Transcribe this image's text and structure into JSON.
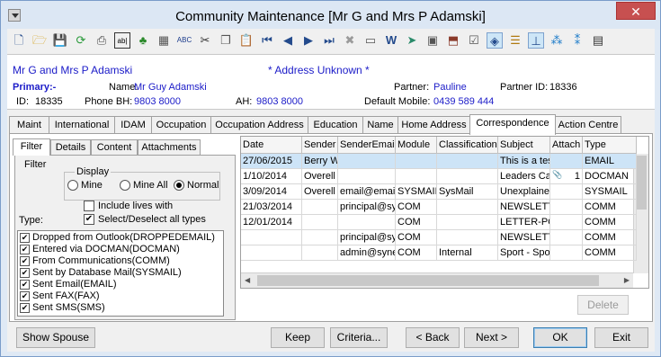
{
  "window": {
    "title": "Community Maintenance  [Mr G and Mrs P Adamski]",
    "close_label": "✕"
  },
  "header": {
    "name": "Mr G and Mrs P Adamski",
    "address_status": "* Address Unknown *",
    "primary_label": "Primary:-",
    "name_label": "Name:",
    "name_value": "Mr Guy Adamski",
    "partner_label": "Partner:",
    "partner_value": "Pauline",
    "partner_id_label": "Partner ID:",
    "partner_id_value": "18336",
    "id_label": "ID:",
    "id_value": "18335",
    "phone_bh_label": "Phone BH:",
    "phone_bh_value": "9803 8000",
    "ah_label": "AH:",
    "ah_value": "9803 8000",
    "default_mobile_label": "Default Mobile:",
    "default_mobile_value": "0439 589 444"
  },
  "tabs": [
    "Maint",
    "International",
    "IDAM",
    "Occupation",
    "Occupation Address",
    "Education",
    "Name",
    "Home Address",
    "Correspondence",
    "Action Centre"
  ],
  "subtabs": [
    "Filter",
    "Details",
    "Content",
    "Attachments"
  ],
  "filter": {
    "title": "Filter",
    "display_title": "Display",
    "radios": [
      "Mine",
      "Mine All",
      "Normal"
    ],
    "include_lives": "Include lives with",
    "select_all": "Select/Deselect all types",
    "type_label": "Type:",
    "types": [
      "Dropped from Outlook(DROPPEDEMAIL)",
      "Entered via DOCMAN(DOCMAN)",
      "From Communications(COMM)",
      "Sent by Database Mail(SYSMAIL)",
      "Sent Email(EMAIL)",
      "Sent FAX(FAX)",
      "Sent SMS(SMS)"
    ]
  },
  "grid": {
    "columns": [
      "Date",
      "Sender",
      "SenderEmail",
      "Module",
      "Classification",
      "Subject",
      "Attach",
      "Type"
    ],
    "rows": [
      [
        "27/06/2015",
        "Berry W",
        "",
        "",
        "",
        "This is a tes",
        "",
        "EMAIL"
      ],
      [
        "1/10/2014",
        "Overell S",
        "",
        "",
        "",
        "Leaders Car",
        "1",
        "DOCMAN"
      ],
      [
        "3/09/2014",
        "Overell S",
        "email@emailx",
        "SYSMAIL",
        "SysMail",
        "Unexplained",
        "",
        "SYSMAIL"
      ],
      [
        "21/03/2014",
        "",
        "principal@sy",
        "COM",
        "",
        "NEWSLETTE",
        "",
        "COMM"
      ],
      [
        "12/01/2014",
        "",
        "",
        "COM",
        "",
        "LETTER-PC-",
        "",
        "COMM"
      ],
      [
        "",
        "",
        "principal@sy",
        "COM",
        "",
        "NEWSLETTE",
        "",
        "COMM"
      ],
      [
        "",
        "",
        "admin@syne",
        "COM",
        "Internal",
        "Sport - Spor",
        "",
        "COMM"
      ]
    ]
  },
  "buttons": {
    "delete": "Delete",
    "show_spouse": "Show Spouse",
    "keep": "Keep",
    "criteria": "Criteria...",
    "back": "< Back",
    "next": "Next >",
    "ok": "OK",
    "exit": "Exit"
  },
  "toolbar_icons": [
    "new-icon",
    "open-icon",
    "save-icon",
    "refresh-icon",
    "print-icon",
    "text-icon",
    "tree-icon",
    "calculator-icon",
    "spellcheck-icon",
    "cut-icon",
    "copy-icon",
    "paste-icon",
    "first-icon",
    "previous-icon",
    "next-icon",
    "last-icon",
    "delete-icon",
    "card-icon",
    "word-icon",
    "send-icon",
    "clipboard-icon",
    "inbox-icon",
    "clipboard-check-icon",
    "tag-icon",
    "checklist-icon",
    "pin-icon",
    "people-icon",
    "group-icon",
    "film-icon"
  ]
}
